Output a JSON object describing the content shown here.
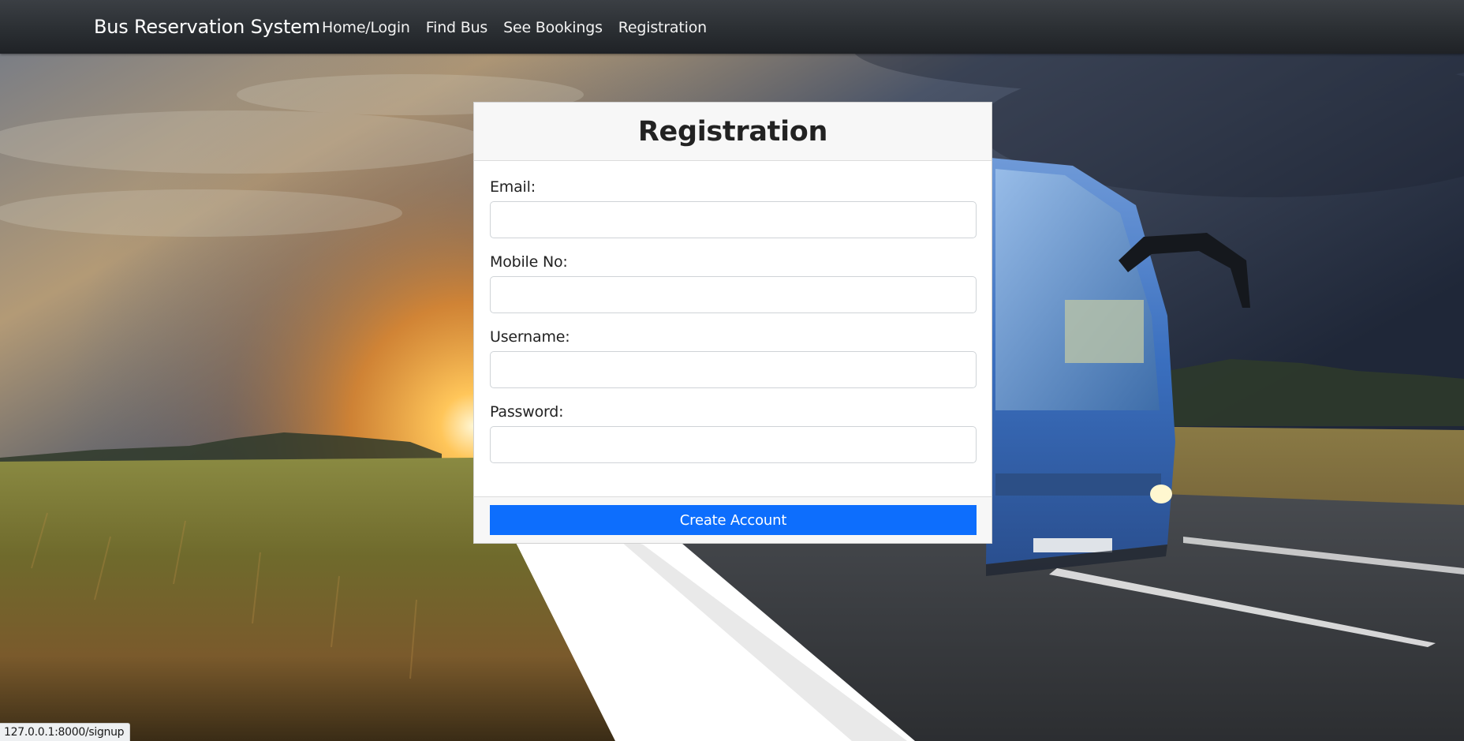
{
  "navbar": {
    "brand": "Bus Reservation System",
    "links": [
      {
        "label": "Home/Login"
      },
      {
        "label": "Find Bus"
      },
      {
        "label": "See Bookings"
      },
      {
        "label": "Registration"
      }
    ]
  },
  "form": {
    "title": "Registration",
    "fields": [
      {
        "label": "Email:",
        "value": "",
        "placeholder": ""
      },
      {
        "label": "Mobile No:",
        "value": "",
        "placeholder": ""
      },
      {
        "label": "Username:",
        "value": "",
        "placeholder": ""
      },
      {
        "label": "Password:",
        "value": "",
        "placeholder": ""
      }
    ],
    "submit_label": "Create Account"
  },
  "status_bar": {
    "url": "127.0.0.1:8000/signup"
  },
  "background": {
    "description_icon": "bus-on-road-sunset-photo"
  },
  "colors": {
    "navbar": "#2b2f33",
    "primary": "#0d6efd",
    "card_header": "#f7f7f7"
  }
}
